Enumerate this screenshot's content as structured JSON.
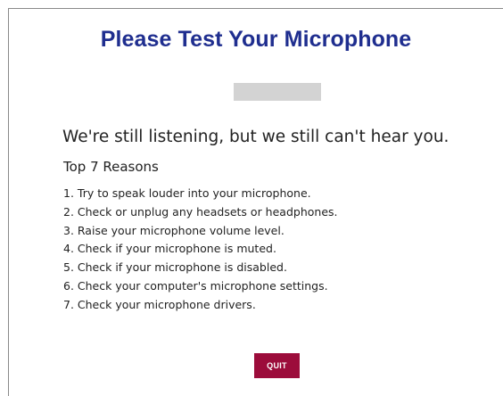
{
  "title": "Please Test Your Microphone",
  "headline": "We're still listening, but we still can't hear you.",
  "subhead": "Top 7 Reasons",
  "reasons": [
    "1. Try to speak louder into your microphone.",
    "2. Check or unplug any headsets or headphones.",
    "3. Raise your microphone volume level.",
    "4. Check if your microphone is muted.",
    "5. Check if your microphone is disabled.",
    "6. Check your computer's microphone settings.",
    "7. Check your microphone drivers."
  ],
  "quit_label": "QUIT",
  "colors": {
    "title": "#1f2e8f",
    "quit_button": "#9c0c3b",
    "meter": "#d3d3d3"
  }
}
